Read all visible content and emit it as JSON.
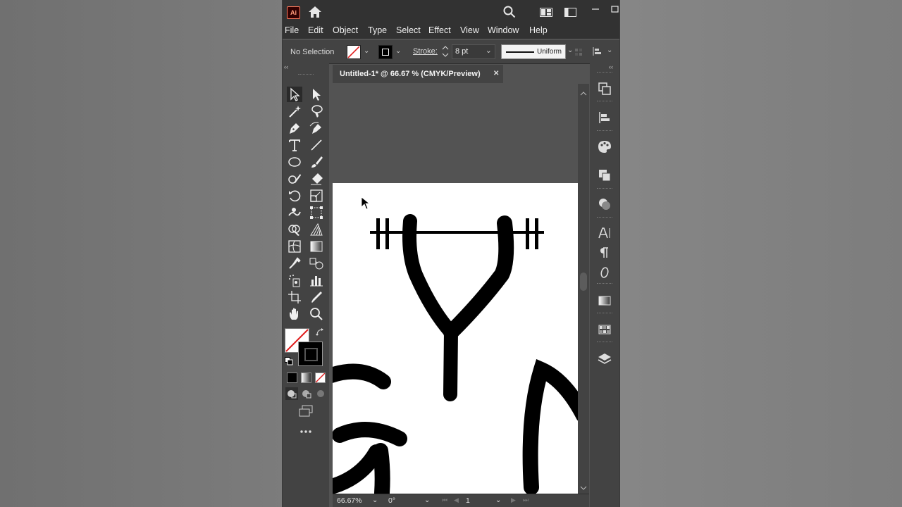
{
  "app": {
    "logo": "Ai"
  },
  "menu": [
    "File",
    "Edit",
    "Object",
    "Type",
    "Select",
    "Effect",
    "View",
    "Window",
    "Help"
  ],
  "control_bar": {
    "selection_status": "No Selection",
    "stroke_label": "Stroke:",
    "stroke_weight": "8 pt",
    "profile": "Uniform"
  },
  "document": {
    "tab_title": "Untitled-1* @ 66.67 % (CMYK/Preview)",
    "close_glyph": "✕"
  },
  "status_bar": {
    "zoom": "66.67%",
    "rotation": "0°",
    "artboard_number": "1"
  },
  "panel_collapse_glyph": "‹‹",
  "right_panel_icons": [
    "properties-icon",
    "align-icon",
    "color-icon",
    "pathfinder-icon",
    "transparency-icon",
    "character-icon",
    "paragraph-icon",
    "opentype-icon",
    "gradient-icon",
    "swatches-icon",
    "layers-icon"
  ],
  "colors": {
    "app_bg": "#535353",
    "panel_bg": "#434343",
    "titlebar_bg": "#323232",
    "artboard": "#ffffff",
    "artwork": "#000000",
    "none_slash": "#e02020"
  }
}
